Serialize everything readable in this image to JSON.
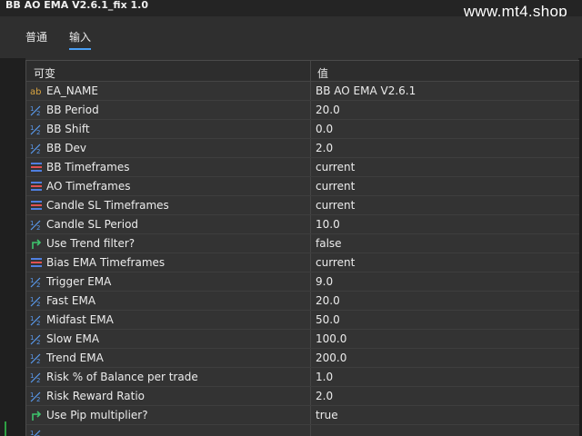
{
  "window": {
    "title": "BB AO EMA V2.6.1_fix 1.0",
    "watermark": "www.mt4.shop"
  },
  "tabs": [
    {
      "label": "普通",
      "active": false
    },
    {
      "label": "输入",
      "active": true
    }
  ],
  "table": {
    "headers": {
      "name": "可变",
      "value": "值"
    },
    "rows": [
      {
        "icon": "string-icon",
        "name": "EA_NAME",
        "value": "BB AO EMA V2.6.1"
      },
      {
        "icon": "number-icon",
        "name": "BB Period",
        "value": "20.0"
      },
      {
        "icon": "number-icon",
        "name": "BB Shift",
        "value": "0.0"
      },
      {
        "icon": "number-icon",
        "name": "BB Dev",
        "value": "2.0"
      },
      {
        "icon": "enum-icon",
        "name": "BB Timeframes",
        "value": "current"
      },
      {
        "icon": "enum-icon",
        "name": "AO Timeframes",
        "value": "current"
      },
      {
        "icon": "enum-icon",
        "name": "Candle SL Timeframes",
        "value": "current"
      },
      {
        "icon": "number-icon",
        "name": "Candle SL Period",
        "value": "10.0"
      },
      {
        "icon": "bool-icon",
        "name": "Use Trend filter?",
        "value": "false"
      },
      {
        "icon": "enum-icon",
        "name": "Bias EMA Timeframes",
        "value": "current"
      },
      {
        "icon": "number-icon",
        "name": "Trigger EMA",
        "value": "9.0"
      },
      {
        "icon": "number-icon",
        "name": "Fast EMA",
        "value": "20.0"
      },
      {
        "icon": "number-icon",
        "name": "Midfast EMA",
        "value": "50.0"
      },
      {
        "icon": "number-icon",
        "name": "Slow EMA",
        "value": "100.0"
      },
      {
        "icon": "number-icon",
        "name": "Trend EMA",
        "value": "200.0"
      },
      {
        "icon": "number-icon",
        "name": "Risk % of Balance per trade",
        "value": "1.0"
      },
      {
        "icon": "number-icon",
        "name": "Risk Reward Ratio",
        "value": "2.0"
      },
      {
        "icon": "bool-icon",
        "name": "Use Pip multiplier?",
        "value": "true"
      },
      {
        "icon": "number-icon",
        "name": "",
        "value": ""
      }
    ]
  },
  "colors": {
    "accent": "#4a9ff5",
    "string_icon": "#d9a441",
    "number_icon": "#5a9bf0",
    "enum_icon_blue": "#4f7fe0",
    "enum_icon_red": "#e05050",
    "bool_icon": "#3ec46d"
  }
}
